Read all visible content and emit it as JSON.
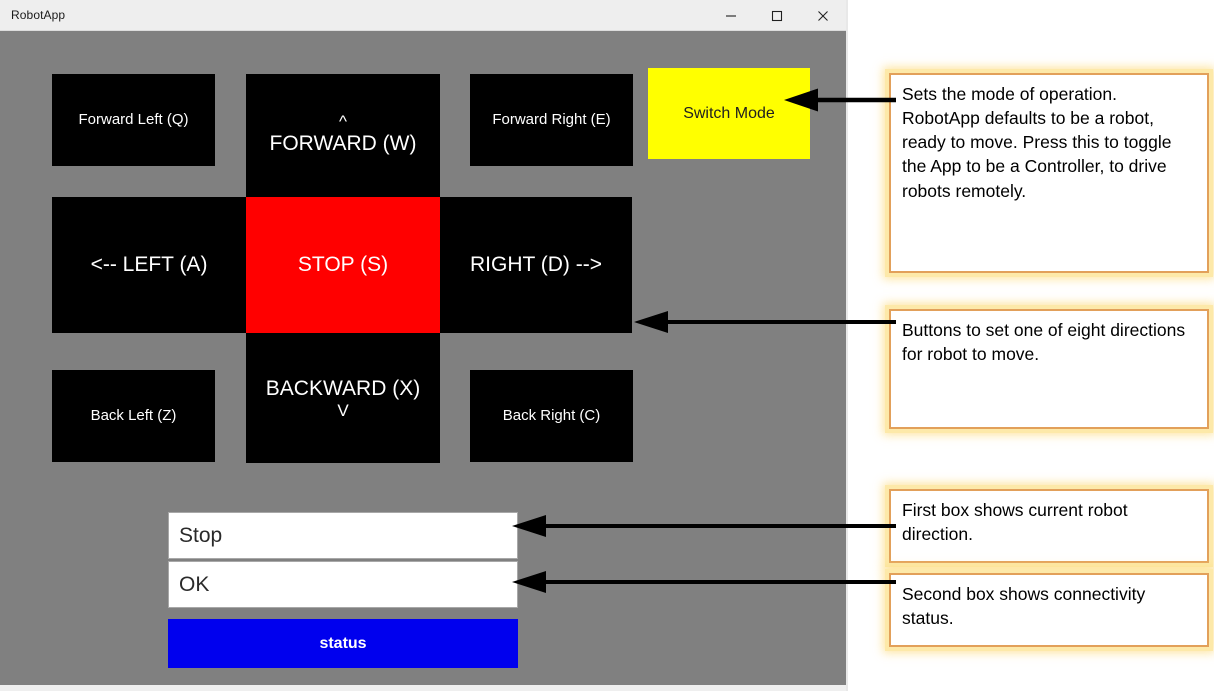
{
  "window": {
    "title": "RobotApp",
    "controls": [
      {
        "name": "minimize",
        "label": "–"
      },
      {
        "name": "maximize",
        "label": "□"
      },
      {
        "name": "close",
        "label": "✕"
      }
    ]
  },
  "colors": {
    "window_background": "#808080",
    "titlebar": "#eeeeee",
    "button_black": "#000000",
    "stop_red": "#ff0000",
    "switch_mode_yellow": "#ffff00",
    "status_blue": "#0000ee",
    "callout_border": "#e2a05a",
    "callout_glow": "#fde9a9"
  },
  "pad": {
    "forward_left": "Forward Left (Q)",
    "forward_caret": "^",
    "forward": "FORWARD (W)",
    "forward_right": "Forward Right (E)",
    "switch_mode": "Switch Mode",
    "left": "<--   LEFT (A)",
    "stop": "STOP (S)",
    "right": "RIGHT (D) -->",
    "backward": "BACKWARD (X)",
    "backward_caret": "V",
    "back_left": "Back Left (Z)",
    "back_right": "Back Right (C)"
  },
  "fields": {
    "direction_value": "Stop",
    "direction_placeholder": "",
    "connectivity_value": "OK",
    "connectivity_placeholder": "",
    "status_button_label": "status"
  },
  "annotations": [
    {
      "id": "mode",
      "text": "Sets the mode of operation. RobotApp defaults to be a robot, ready to move.  Press this to toggle the App to be a Controller, to drive robots remotely."
    },
    {
      "id": "directions",
      "text": "Buttons to set one of eight directions for robot to move."
    },
    {
      "id": "first-box",
      "text": "First box shows current robot direction."
    },
    {
      "id": "second-box",
      "text": "Second box shows connectivity status."
    }
  ]
}
